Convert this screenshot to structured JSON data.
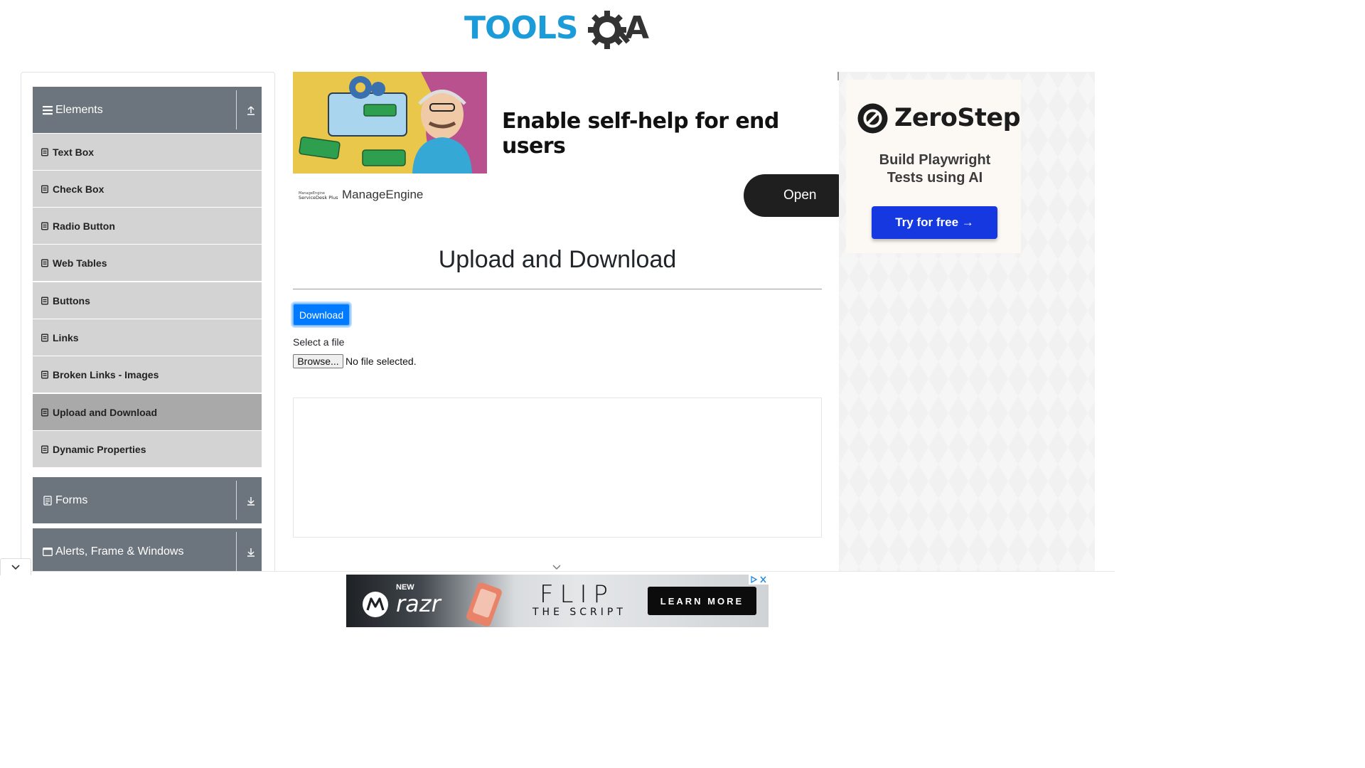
{
  "header": {
    "logo_text": "TOOLSQA"
  },
  "sidebar": {
    "groups": [
      {
        "label": "Elements",
        "state": "expanded"
      },
      {
        "label": "Forms",
        "state": "collapsed"
      },
      {
        "label": "Alerts, Frame & Windows",
        "state": "collapsed"
      }
    ],
    "items": [
      {
        "label": "Text Box"
      },
      {
        "label": "Check Box"
      },
      {
        "label": "Radio Button"
      },
      {
        "label": "Web Tables"
      },
      {
        "label": "Buttons"
      },
      {
        "label": "Links"
      },
      {
        "label": "Broken Links - Images"
      },
      {
        "label": "Upload and Download",
        "active": true
      },
      {
        "label": "Dynamic Properties"
      }
    ]
  },
  "ad_top": {
    "headline": "Enable self-help for end users",
    "brand": "ManageEngine",
    "brand_logo_text": "ManageEngine ServiceDesk Plus",
    "cta": "Open"
  },
  "main": {
    "title": "Upload and Download",
    "download_label": "Download",
    "select_label": "Select a file",
    "browse_label": "Browse...",
    "no_file_text": "No file selected."
  },
  "right_ad": {
    "brand": "ZeroStep",
    "tagline": "Build Playwright Tests using AI",
    "cta": "Try for free →"
  },
  "bottom_ad": {
    "new": "NEW",
    "product": "razr",
    "flip": "FLIP",
    "script": "THE SCRIPT",
    "cta": "LEARN MORE"
  },
  "colors": {
    "sidebar_header": "#6c757d",
    "menu_item": "#d3d3d3",
    "menu_item_active": "#a9a9a9",
    "primary": "#007bff",
    "zerostep_cta": "#1638e0"
  }
}
